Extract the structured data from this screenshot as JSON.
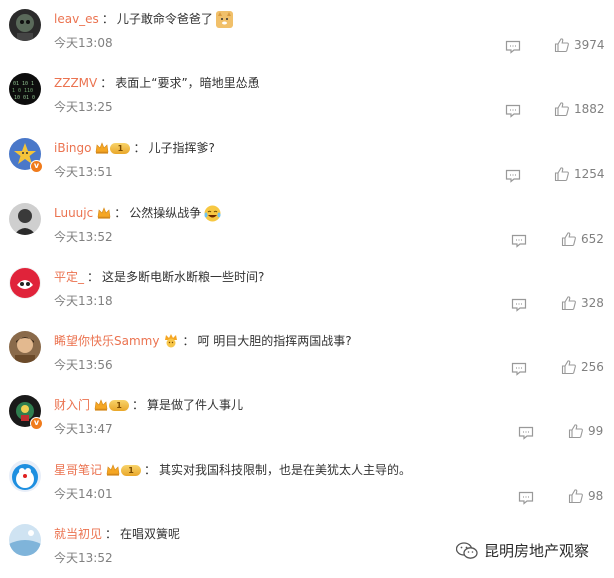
{
  "comments": [
    {
      "user": "leav_es",
      "text": "儿子敢命令爸爸了",
      "time": "今天13:08",
      "likes": "3974",
      "badge": "none",
      "emoji": "doge",
      "verified": false
    },
    {
      "user": "ZZZMV",
      "text": "表面上“要求”，暗地里怂恿",
      "time": "今天13:25",
      "likes": "1882",
      "badge": "none",
      "emoji": "",
      "verified": false
    },
    {
      "user": "iBingo",
      "text": "儿子指挥爹?",
      "time": "今天13:51",
      "likes": "1254",
      "badge": "crown-level",
      "emoji": "",
      "verified": true
    },
    {
      "user": "Luuujc",
      "text": "公然操纵战争",
      "time": "今天13:52",
      "likes": "652",
      "badge": "crown",
      "emoji": "laugh-cry",
      "verified": false
    },
    {
      "user": "平定_",
      "text": "这是多断电断水断粮一些时间?",
      "time": "今天13:18",
      "likes": "328",
      "badge": "none",
      "emoji": "",
      "verified": false
    },
    {
      "user": "睎望你快乐Sammy",
      "text": "呵 明目大胆的指挥两国战事?",
      "time": "今天13:56",
      "likes": "256",
      "badge": "crown-face",
      "emoji": "",
      "verified": false
    },
    {
      "user": "财入门",
      "text": "算是做了件人事儿",
      "time": "今天13:47",
      "likes": "99",
      "badge": "crown-level",
      "emoji": "",
      "verified": true
    },
    {
      "user": "星哥笔记",
      "text": "其实对我国科技限制，也是在美犹太人主导的。",
      "time": "今天14:01",
      "likes": "98",
      "badge": "crown-level",
      "emoji": "",
      "verified": false
    },
    {
      "user": "就当初见",
      "text": "在唱双簧呢",
      "time": "今天13:52",
      "likes": "",
      "badge": "none",
      "emoji": "",
      "verified": false
    }
  ],
  "separator": "：",
  "level_label": "1",
  "watermark": "昆明房地产观察",
  "colors": {
    "username": "#eb7350",
    "text": "#333333",
    "meta": "#808080",
    "crown": "#f5a623",
    "verified": "#f07b1c"
  }
}
